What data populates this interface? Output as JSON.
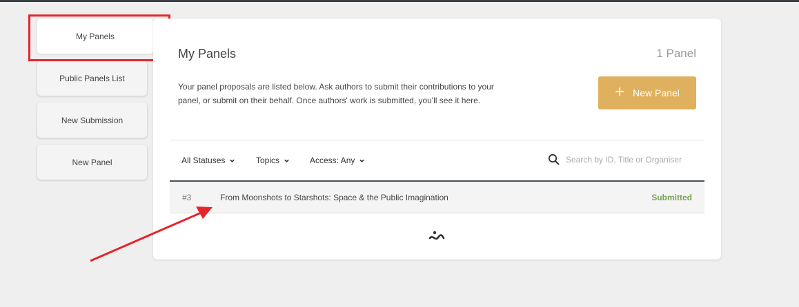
{
  "sidebar": {
    "items": [
      {
        "label": "My Panels",
        "active": true
      },
      {
        "label": "Public Panels List"
      },
      {
        "label": "New Submission"
      },
      {
        "label": "New Panel"
      }
    ]
  },
  "main": {
    "title": "My Panels",
    "count": "1 Panel",
    "intro": "Your panel proposals are listed below. Ask authors to submit their contributions to your panel, or submit on their behalf. Once authors' work is submitted, you'll see it here.",
    "new_button_label": "New Panel",
    "filters": {
      "status": "All Statuses",
      "topics": "Topics",
      "access": "Access: Any"
    },
    "search": {
      "placeholder": "Search by ID, Title or Organiser"
    },
    "rows": [
      {
        "id": "#3",
        "title": "From Moonshots to Starshots: Space & the Public Imagination",
        "status": "Submitted"
      }
    ]
  },
  "colors": {
    "accent": "#dfb05d",
    "status_submitted": "#7ba152",
    "annotation": "#e8232a"
  }
}
